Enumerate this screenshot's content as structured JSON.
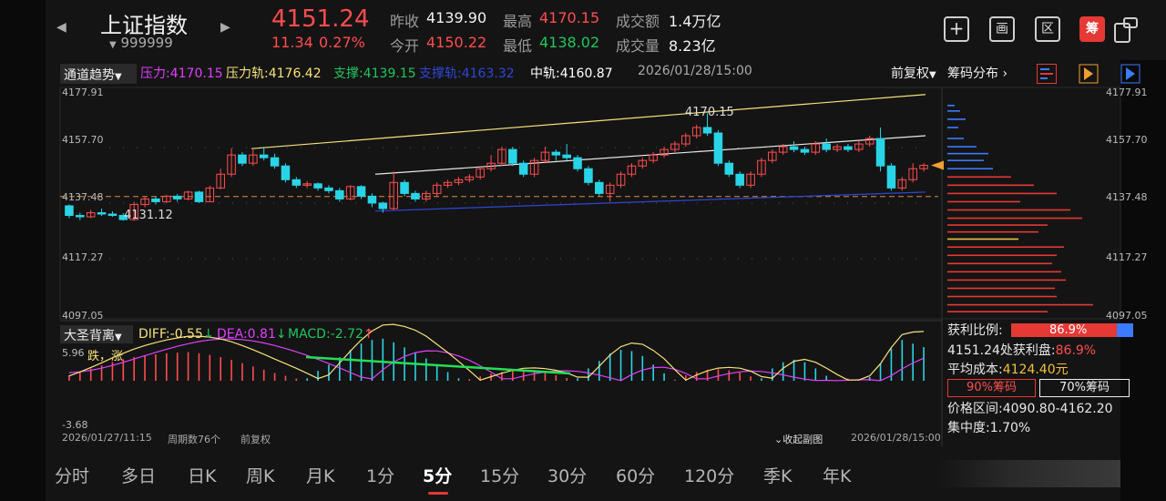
{
  "header": {
    "name": "上证指数",
    "code": "999999",
    "price": "4151.24",
    "change": "11.34",
    "change_pct": "0.27%",
    "prev_close_label": "昨收",
    "prev_close": "4139.90",
    "open_label": "今开",
    "open": "4150.22",
    "high_label": "最高",
    "high": "4170.15",
    "low_label": "最低",
    "low": "4138.02",
    "amount_label": "成交额",
    "amount": "1.4万亿",
    "volume_label": "成交量",
    "volume": "8.23亿",
    "tools": [
      "+",
      "画",
      "区",
      "筹"
    ]
  },
  "main_chart": {
    "indicator": "通道趋势",
    "pressure": "压力:4170.15",
    "pressure_rail": "压力轨:4176.42",
    "support": "支撑:4139.15",
    "support_rail": "支撑轨:4163.32",
    "mid_rail": "中轨:4160.87",
    "datetime": "2026/01/28/15:00",
    "adjust": "前复权",
    "chip_title": "筹码分布",
    "y_ticks": [
      "4177.91",
      "4157.70",
      "4137.48",
      "4117.27",
      "4097.05"
    ],
    "high_label": "4170.15",
    "low_label": "4131.12",
    "colors": {
      "up": "#ff4d4f",
      "down": "#29d4e6",
      "pressure": "#f6e27a",
      "support": "#2e46d6",
      "mid": "#e8e8e8"
    },
    "candles": [
      [
        4136.5,
        4133.0,
        4137.0,
        4132.0
      ],
      [
        4133.0,
        4132.5,
        4134.0,
        4131.3
      ],
      [
        4132.5,
        4134.0,
        4135.0,
        4132.0
      ],
      [
        4134.0,
        4133.5,
        4135.5,
        4132.8
      ],
      [
        4133.5,
        4133.0,
        4134.5,
        4132.5
      ],
      [
        4133.0,
        4131.5,
        4133.8,
        4131.1
      ],
      [
        4131.5,
        4137.0,
        4138.0,
        4131.0
      ],
      [
        4137.0,
        4139.0,
        4140.0,
        4136.0
      ],
      [
        4139.0,
        4138.0,
        4140.0,
        4137.0
      ],
      [
        4138.0,
        4140.0,
        4140.5,
        4137.5
      ],
      [
        4140.0,
        4139.0,
        4140.8,
        4138.0
      ],
      [
        4139.0,
        4141.5,
        4142.0,
        4138.5
      ],
      [
        4141.5,
        4138.0,
        4142.0,
        4137.5
      ],
      [
        4138.0,
        4143.0,
        4143.8,
        4137.8
      ],
      [
        4143.0,
        4148.0,
        4150.0,
        4142.5
      ],
      [
        4148.0,
        4155.0,
        4157.5,
        4147.0
      ],
      [
        4155.0,
        4152.0,
        4156.0,
        4151.0
      ],
      [
        4152.0,
        4155.0,
        4157.0,
        4151.0
      ],
      [
        4155.0,
        4154.0,
        4158.0,
        4153.0
      ],
      [
        4154.0,
        4151.0,
        4155.5,
        4150.0
      ],
      [
        4151.0,
        4146.0,
        4152.0,
        4145.0
      ],
      [
        4146.0,
        4144.0,
        4147.0,
        4143.0
      ],
      [
        4144.0,
        4144.5,
        4145.5,
        4143.0
      ],
      [
        4144.5,
        4143.0,
        4145.0,
        4142.0
      ],
      [
        4143.0,
        4142.0,
        4144.0,
        4141.0
      ],
      [
        4142.0,
        4139.0,
        4143.0,
        4138.0
      ],
      [
        4139.0,
        4143.5,
        4144.0,
        4138.5
      ],
      [
        4143.5,
        4140.0,
        4144.0,
        4139.0
      ],
      [
        4140.0,
        4137.5,
        4141.0,
        4136.0
      ],
      [
        4137.5,
        4135.5,
        4138.0,
        4134.0
      ],
      [
        4135.5,
        4145.0,
        4149.0,
        4135.0
      ],
      [
        4145.0,
        4141.0,
        4146.0,
        4140.0
      ],
      [
        4141.0,
        4139.0,
        4142.0,
        4138.0
      ],
      [
        4139.0,
        4141.0,
        4142.0,
        4138.0
      ],
      [
        4141.0,
        4144.0,
        4145.0,
        4140.0
      ],
      [
        4144.0,
        4145.0,
        4146.0,
        4143.0
      ],
      [
        4145.0,
        4146.0,
        4147.0,
        4144.0
      ],
      [
        4146.0,
        4147.0,
        4148.0,
        4145.0
      ],
      [
        4147.0,
        4150.0,
        4151.0,
        4146.0
      ],
      [
        4150.0,
        4152.0,
        4155.0,
        4149.0
      ],
      [
        4152.0,
        4157.0,
        4158.0,
        4151.0
      ],
      [
        4157.0,
        4152.0,
        4158.0,
        4151.0
      ],
      [
        4152.0,
        4148.0,
        4153.0,
        4147.0
      ],
      [
        4148.0,
        4153.0,
        4154.0,
        4147.0
      ],
      [
        4153.0,
        4156.0,
        4158.0,
        4152.0
      ],
      [
        4156.0,
        4155.0,
        4157.0,
        4153.0
      ],
      [
        4155.0,
        4154.0,
        4159.0,
        4153.0
      ],
      [
        4154.0,
        4150.0,
        4155.0,
        4149.0
      ],
      [
        4150.0,
        4145.0,
        4151.0,
        4144.0
      ],
      [
        4145.0,
        4141.0,
        4146.0,
        4140.0
      ],
      [
        4141.0,
        4144.0,
        4145.0,
        4138.0
      ],
      [
        4144.0,
        4148.0,
        4149.0,
        4143.0
      ],
      [
        4148.0,
        4151.0,
        4152.0,
        4147.0
      ],
      [
        4151.0,
        4153.0,
        4154.0,
        4150.0
      ],
      [
        4153.0,
        4155.0,
        4156.0,
        4152.0
      ],
      [
        4155.0,
        4157.0,
        4158.0,
        4154.0
      ],
      [
        4157.0,
        4159.0,
        4160.0,
        4156.0
      ],
      [
        4159.0,
        4162.0,
        4163.0,
        4158.0
      ],
      [
        4162.0,
        4165.0,
        4166.0,
        4161.0
      ],
      [
        4165.0,
        4163.0,
        4170.15,
        4162.0
      ],
      [
        4163.0,
        4152.0,
        4164.0,
        4151.0
      ],
      [
        4152.0,
        4148.0,
        4153.0,
        4147.0
      ],
      [
        4148.0,
        4144.0,
        4149.0,
        4143.0
      ],
      [
        4144.0,
        4148.0,
        4149.0,
        4143.0
      ],
      [
        4148.0,
        4153.0,
        4154.0,
        4147.0
      ],
      [
        4153.0,
        4156.0,
        4157.0,
        4152.0
      ],
      [
        4156.0,
        4158.0,
        4159.0,
        4155.0
      ],
      [
        4158.0,
        4157.0,
        4160.0,
        4156.0
      ],
      [
        4157.0,
        4156.0,
        4158.0,
        4155.0
      ],
      [
        4156.0,
        4159.0,
        4160.0,
        4155.0
      ],
      [
        4159.0,
        4157.0,
        4161.0,
        4156.0
      ],
      [
        4157.0,
        4158.0,
        4159.0,
        4156.0
      ],
      [
        4158.0,
        4157.0,
        4159.0,
        4156.0
      ],
      [
        4157.0,
        4159.0,
        4160.0,
        4156.0
      ],
      [
        4159.0,
        4161.0,
        4162.0,
        4158.0
      ],
      [
        4161.0,
        4151.0,
        4165.0,
        4149.0
      ],
      [
        4151.0,
        4143.0,
        4152.0,
        4142.0
      ],
      [
        4143.0,
        4146.0,
        4147.0,
        4142.0
      ],
      [
        4146.0,
        4150.0,
        4152.0,
        4145.0
      ],
      [
        4150.0,
        4151.24,
        4152.0,
        4149.0
      ]
    ]
  },
  "chips": {
    "bins": [
      {
        "p": 4173.0,
        "w": 8,
        "c": "b"
      },
      {
        "p": 4171.0,
        "w": 14,
        "c": "b"
      },
      {
        "p": 4168.0,
        "w": 20,
        "c": "b"
      },
      {
        "p": 4165.0,
        "w": 12,
        "c": "b"
      },
      {
        "p": 4161.0,
        "w": 18,
        "c": "b"
      },
      {
        "p": 4158.0,
        "w": 32,
        "c": "b"
      },
      {
        "p": 4155.5,
        "w": 45,
        "c": "b"
      },
      {
        "p": 4153.0,
        "w": 40,
        "c": "b"
      },
      {
        "p": 4150.0,
        "w": 50,
        "c": "b"
      },
      {
        "p": 4147.0,
        "w": 70,
        "c": "r"
      },
      {
        "p": 4144.0,
        "w": 95,
        "c": "r"
      },
      {
        "p": 4141.0,
        "w": 120,
        "c": "r"
      },
      {
        "p": 4138.0,
        "w": 80,
        "c": "r"
      },
      {
        "p": 4135.0,
        "w": 135,
        "c": "r"
      },
      {
        "p": 4132.0,
        "w": 148,
        "c": "r"
      },
      {
        "p": 4129.5,
        "w": 110,
        "c": "r"
      },
      {
        "p": 4127.0,
        "w": 100,
        "c": "r"
      },
      {
        "p": 4124.4,
        "w": 78,
        "c": "y"
      },
      {
        "p": 4121.5,
        "w": 128,
        "c": "r"
      },
      {
        "p": 4118.5,
        "w": 120,
        "c": "r"
      },
      {
        "p": 4115.5,
        "w": 115,
        "c": "r"
      },
      {
        "p": 4112.5,
        "w": 125,
        "c": "r"
      },
      {
        "p": 4109.5,
        "w": 130,
        "c": "r"
      },
      {
        "p": 4106.5,
        "w": 118,
        "c": "r"
      },
      {
        "p": 4103.5,
        "w": 120,
        "c": "r"
      },
      {
        "p": 4100.5,
        "w": 160,
        "c": "r"
      },
      {
        "p": 4098.0,
        "w": 110,
        "c": "r"
      }
    ]
  },
  "sub_chart": {
    "indicator": "大圣背离",
    "diff": "DIFF:-0.55",
    "dea": "DEA:0.81",
    "macd": "MACD:-2.72",
    "top_value": "5.96",
    "bottom_value": "-3.68",
    "signal_text": "跌，涨",
    "start_time": "2026/01/27/11:15",
    "period": "周期数76个",
    "adjust": "前复权",
    "collapse": "收起副图",
    "end_time": "2026/01/28/15:00",
    "macd_bars": [
      1.0,
      1.6,
      2.2,
      2.8,
      3.4,
      3.9,
      4.3,
      4.6,
      4.8,
      5.0,
      5.1,
      5.2,
      5.0,
      4.7,
      4.3,
      3.8,
      3.2,
      2.6,
      2.0,
      1.4,
      0.9,
      0.4,
      -0.2,
      -0.8,
      -1.3,
      -1.9,
      -2.5,
      -3.0,
      -3.3,
      -3.4,
      -3.1,
      -2.7,
      -2.3,
      -1.8,
      -1.2,
      -0.7,
      -0.2,
      0.3,
      0.8,
      1.3,
      1.6,
      1.8,
      1.9,
      1.7,
      1.4,
      1.0,
      0.5,
      -0.2,
      -1.0,
      -1.6,
      -2.2,
      -2.5,
      -2.4,
      -2.0,
      -1.3,
      -0.6,
      0.2,
      1.0,
      1.6,
      2.0,
      2.1,
      1.9,
      1.5,
      0.8,
      -0.2,
      -1.0,
      -1.5,
      -1.7,
      -1.5,
      -1.0,
      -0.4,
      0.1,
      0.4,
      0.2,
      -0.3,
      -1.4,
      -2.6,
      -3.3,
      -3.0,
      -2.72
    ]
  },
  "chip_info": {
    "profit_ratio_label": "获利比例:",
    "profit_ratio": "86.9%",
    "profit_at_price": "4151.24处获利盘:",
    "profit_at_value": "86.9%",
    "avg_cost_label": "平均成本:",
    "avg_cost": "4124.40元",
    "chip90": "90%筹码",
    "chip70": "70%筹码",
    "range_label": "价格区间:",
    "range": "4090.80-4162.20",
    "concentration_label": "集中度:",
    "concentration": "1.70%",
    "profit_ratio_value": 0.869
  },
  "tabs": [
    "分时",
    "多日",
    "日K",
    "周K",
    "月K",
    "1分",
    "5分",
    "15分",
    "30分",
    "60分",
    "120分",
    "季K",
    "年K"
  ],
  "active_tab": "5分"
}
